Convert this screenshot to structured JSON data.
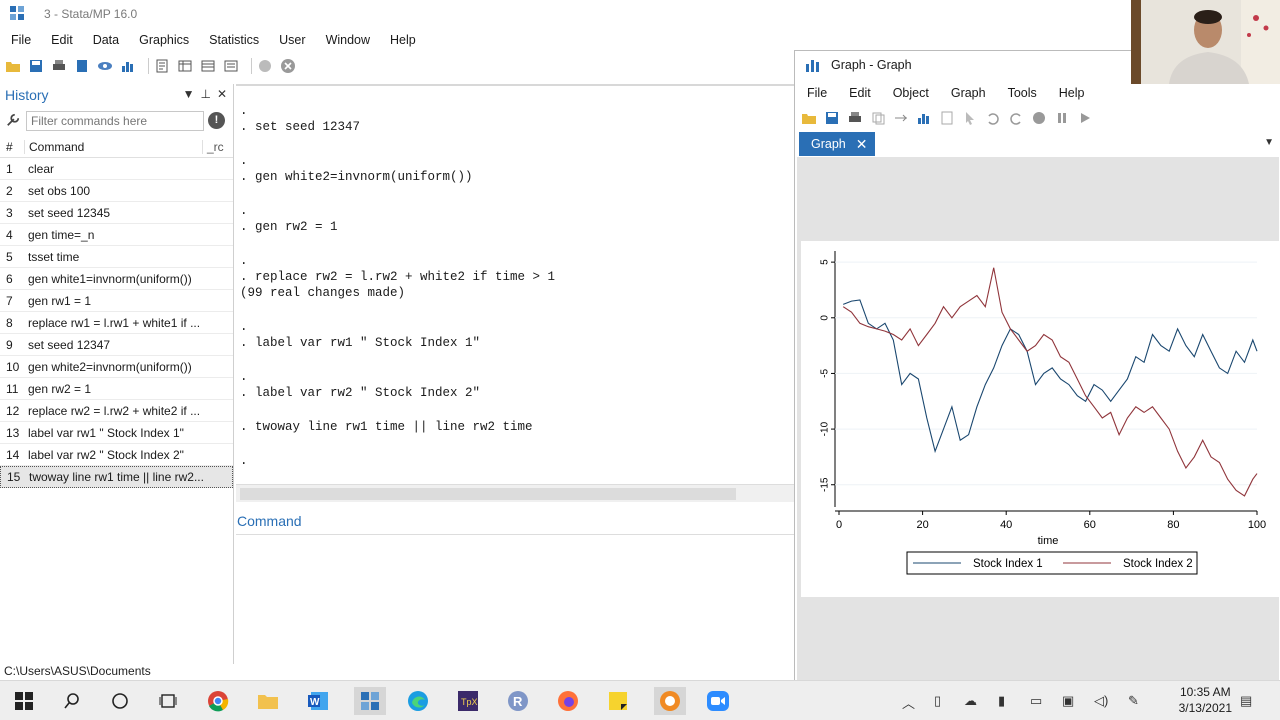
{
  "window": {
    "title": "3 - Stata/MP 16.0"
  },
  "menu": [
    "File",
    "Edit",
    "Data",
    "Graphics",
    "Statistics",
    "User",
    "Window",
    "Help"
  ],
  "history": {
    "title": "History",
    "filter_placeholder": "Filter commands here",
    "col_num": "#",
    "col_command": "Command",
    "col_rc": "_rc",
    "items": [
      {
        "n": "1",
        "cmd": "clear"
      },
      {
        "n": "2",
        "cmd": "set obs 100"
      },
      {
        "n": "3",
        "cmd": "set seed 12345"
      },
      {
        "n": "4",
        "cmd": "gen time=_n"
      },
      {
        "n": "5",
        "cmd": "tsset time"
      },
      {
        "n": "6",
        "cmd": "gen white1=invnorm(uniform())"
      },
      {
        "n": "7",
        "cmd": "gen rw1 = 1"
      },
      {
        "n": "8",
        "cmd": "replace rw1 = l.rw1 + white1 if ..."
      },
      {
        "n": "9",
        "cmd": "set seed 12347"
      },
      {
        "n": "10",
        "cmd": "gen white2=invnorm(uniform())"
      },
      {
        "n": "11",
        "cmd": "gen rw2 = 1"
      },
      {
        "n": "12",
        "cmd": "replace rw2 = l.rw2 + white2 if ..."
      },
      {
        "n": "13",
        "cmd": "label var rw1 \" Stock Index 1\""
      },
      {
        "n": "14",
        "cmd": "label var rw2 \" Stock Index 2\""
      },
      {
        "n": "15",
        "cmd": "twoway line rw1 time || line rw2..."
      }
    ]
  },
  "results": [
    ".",
    ". set seed 12347",
    ".",
    ". gen white2=invnorm(uniform())",
    ".",
    ". gen rw2 = 1",
    ".",
    ". replace rw2 = l.rw2 + white2 if time > 1",
    "(99 real changes made)",
    ".",
    ". label var rw1 \" Stock Index 1\"",
    ".",
    ". label var rw2 \" Stock Index 2\"",
    ". twoway line rw1 time || line rw2 time",
    "."
  ],
  "command": {
    "title": "Command"
  },
  "status": {
    "path": "C:\\Users\\ASUS\\Documents"
  },
  "graph_window": {
    "title": "Graph - Graph",
    "menu": [
      "File",
      "Edit",
      "Object",
      "Graph",
      "Tools",
      "Help"
    ],
    "tab": "Graph"
  },
  "chart_data": {
    "type": "line",
    "xlabel": "time",
    "ylabel": "",
    "xlim": [
      0,
      100
    ],
    "ylim": [
      -17,
      6
    ],
    "xticks": [
      "0",
      "20",
      "40",
      "60",
      "80",
      "100"
    ],
    "yticks": [
      "5",
      "0",
      "-5",
      "-10",
      "-15"
    ],
    "legend_placement": "bottom",
    "series": [
      {
        "name": "Stock Index 1",
        "color": "#1a476f",
        "x": [
          1,
          3,
          5,
          7,
          9,
          11,
          13,
          15,
          17,
          19,
          21,
          23,
          25,
          27,
          29,
          31,
          33,
          35,
          37,
          39,
          41,
          43,
          45,
          47,
          49,
          51,
          53,
          55,
          57,
          59,
          61,
          63,
          65,
          67,
          69,
          71,
          73,
          75,
          77,
          79,
          81,
          83,
          85,
          87,
          89,
          91,
          93,
          95,
          97,
          99,
          100
        ],
        "y": [
          1.2,
          1.5,
          1.6,
          -0.5,
          -1.0,
          -0.5,
          -2.0,
          -6.0,
          -5.0,
          -5.5,
          -9.0,
          -12.0,
          -10.0,
          -8.0,
          -11.0,
          -10.5,
          -8.0,
          -6.0,
          -4.5,
          -2.5,
          -1.0,
          -1.5,
          -3.0,
          -6.0,
          -5.0,
          -4.5,
          -5.5,
          -6.0,
          -7.0,
          -7.5,
          -6.0,
          -6.5,
          -7.5,
          -6.5,
          -5.5,
          -3.5,
          -4.0,
          -1.5,
          -2.5,
          -3.0,
          -1.0,
          -2.5,
          -3.5,
          -1.5,
          -3.0,
          -4.5,
          -5.0,
          -3.0,
          -4.0,
          -2.0,
          -3.0
        ]
      },
      {
        "name": "Stock Index 2",
        "color": "#90353b",
        "x": [
          1,
          3,
          5,
          7,
          9,
          11,
          13,
          15,
          17,
          19,
          21,
          23,
          25,
          27,
          29,
          31,
          33,
          35,
          37,
          39,
          41,
          43,
          45,
          47,
          49,
          51,
          53,
          55,
          57,
          59,
          61,
          63,
          65,
          67,
          69,
          71,
          73,
          75,
          77,
          79,
          81,
          83,
          85,
          87,
          89,
          91,
          93,
          95,
          97,
          99,
          100
        ],
        "y": [
          1.0,
          0.5,
          -0.5,
          -0.8,
          -1.0,
          -1.2,
          -1.5,
          -2.0,
          -1.0,
          -2.5,
          -1.5,
          -0.5,
          1.0,
          0.0,
          1.0,
          1.5,
          2.0,
          1.0,
          4.5,
          0.5,
          -1.0,
          -2.0,
          -3.0,
          -2.5,
          -1.5,
          -2.0,
          -3.5,
          -4.0,
          -5.5,
          -7.0,
          -8.0,
          -9.0,
          -8.5,
          -10.5,
          -9.0,
          -8.0,
          -8.5,
          -8.0,
          -9.0,
          -10.0,
          -12.0,
          -13.5,
          -12.5,
          -11.0,
          -12.5,
          -13.0,
          -14.5,
          -15.5,
          -16.0,
          -14.5,
          -14.0
        ]
      }
    ]
  },
  "taskbar": {
    "time": "10:35 AM",
    "date": "3/13/2021"
  }
}
